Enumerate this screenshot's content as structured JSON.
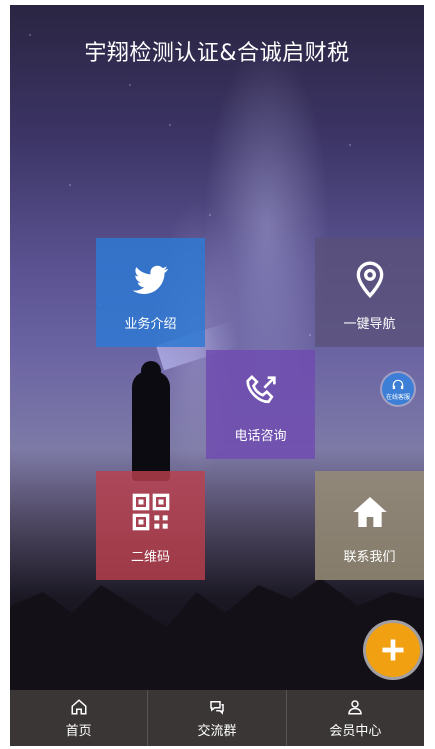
{
  "header": {
    "title": "宇翔检测认证&合诚启财税"
  },
  "tiles": [
    {
      "label": "业务介绍",
      "icon": "twitter-bird-icon"
    },
    {
      "label": "一键导航",
      "icon": "map-pin-icon"
    },
    {
      "label": "电话咨询",
      "icon": "phone-icon"
    },
    {
      "label": "二维码",
      "icon": "qr-code-icon"
    },
    {
      "label": "联系我们",
      "icon": "home-icon"
    }
  ],
  "online_service": {
    "label": "在线客服",
    "icon": "headset-icon"
  },
  "fab": {
    "icon": "plus-icon",
    "color": "#f0a010"
  },
  "bottom_nav": [
    {
      "label": "首页",
      "icon": "home-icon"
    },
    {
      "label": "交流群",
      "icon": "chat-icon"
    },
    {
      "label": "会员中心",
      "icon": "user-icon"
    }
  ]
}
